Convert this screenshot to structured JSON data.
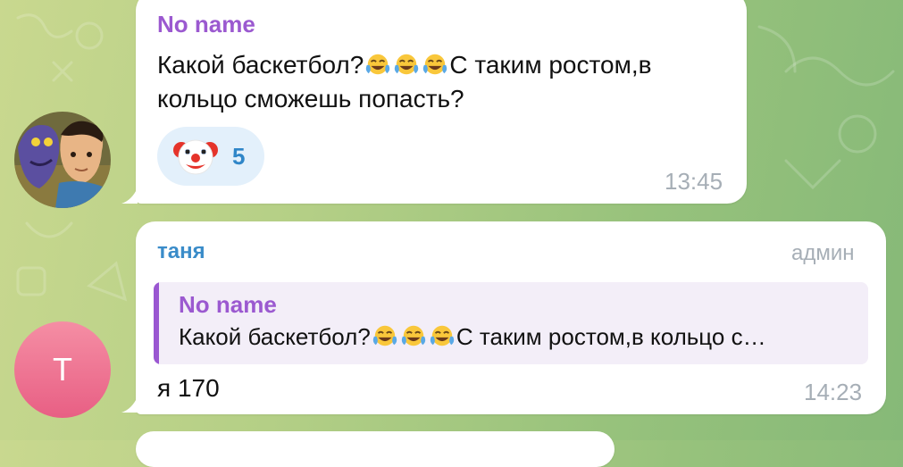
{
  "messages": [
    {
      "sender": "No name",
      "text_before_emoji": "Какой баскетбол?",
      "emojis": [
        "tears-of-joy-emoji",
        "tears-of-joy-emoji",
        "tears-of-joy-emoji"
      ],
      "text_after_emoji": "С таким ростом,в",
      "text_line2": "кольцо сможешь попасть?",
      "reaction": {
        "emoji": "clown-face-emoji",
        "count": "5"
      },
      "time": "13:45",
      "sender_color": "#9b59d0"
    },
    {
      "sender": "таня",
      "role": "админ",
      "sender_color": "#3a8cc9",
      "reply": {
        "sender": "No name",
        "text_before_emoji": "Какой баскетбол?",
        "text_after_emoji": "С таким ростом,в кольцо с…"
      },
      "text": "я 170",
      "time": "14:23",
      "avatar_letter": "Т"
    }
  ],
  "colors": {
    "reply_bar": "#9a57d1",
    "reaction_bg": "#e3f0fb",
    "time": "#a6aeb6",
    "avatar_pink": "#ef7794"
  }
}
